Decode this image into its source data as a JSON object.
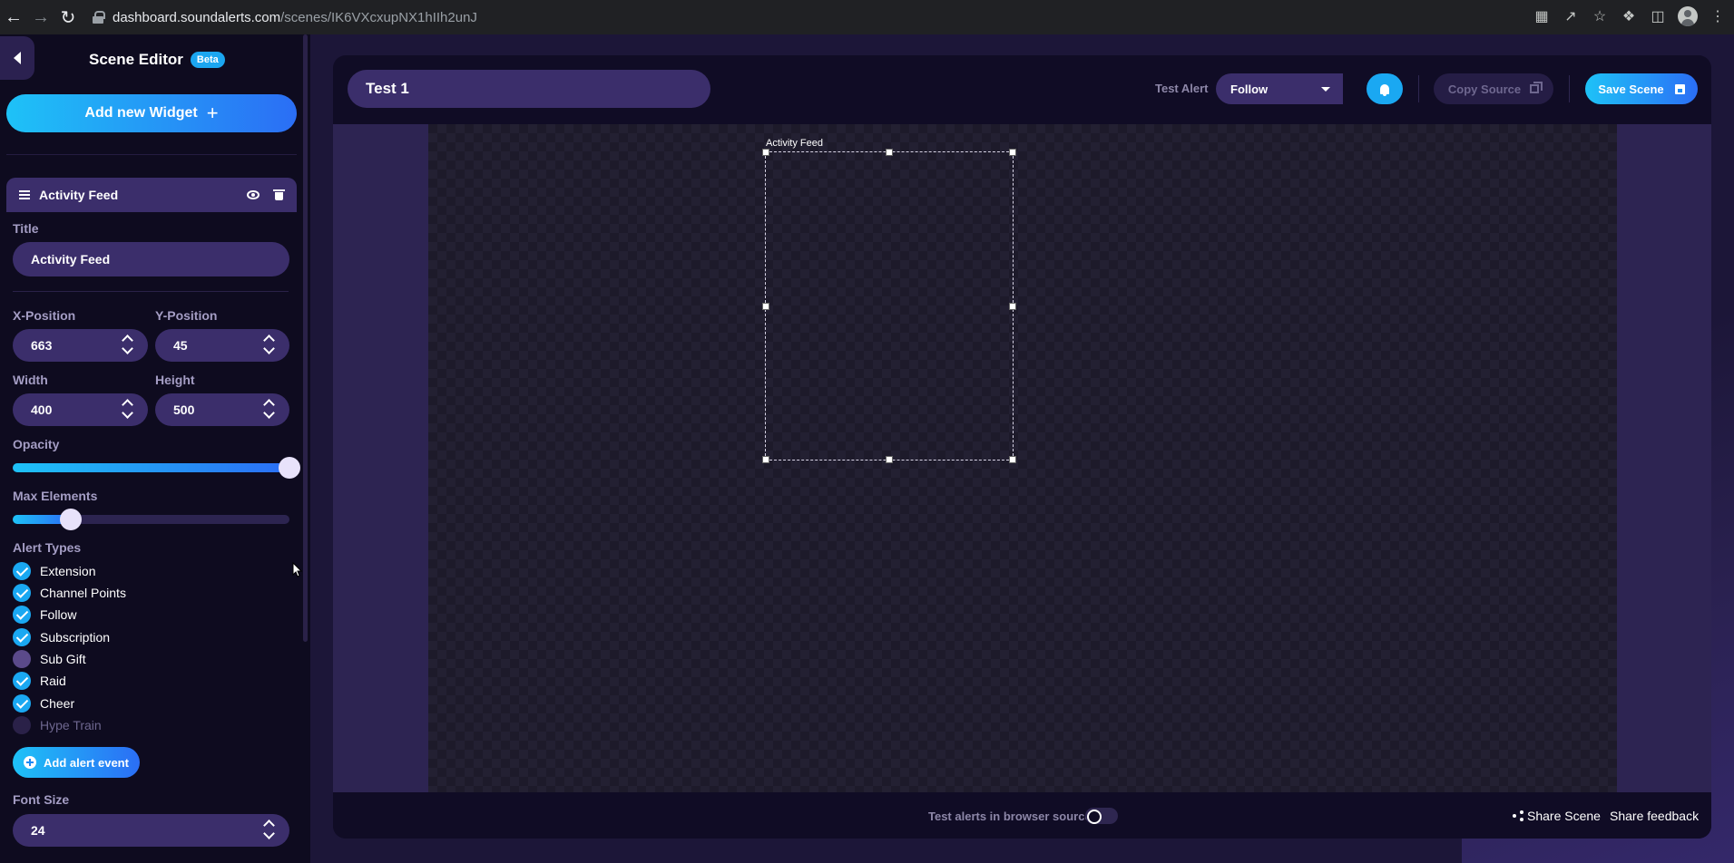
{
  "browser": {
    "url_host": "dashboard.soundalerts.com",
    "url_path": "/scenes/IK6VXcxupNX1hIIh2unJ"
  },
  "sidebar": {
    "title": "Scene Editor",
    "badge": "Beta",
    "add_widget_label": "Add new Widget",
    "widget": {
      "name": "Activity Feed",
      "title_label": "Title",
      "title_value": "Activity Feed",
      "x_label": "X-Position",
      "x_value": "663",
      "y_label": "Y-Position",
      "y_value": "45",
      "width_label": "Width",
      "width_value": "400",
      "height_label": "Height",
      "height_value": "500",
      "opacity_label": "Opacity",
      "opacity_level": 1.0,
      "max_elements_label": "Max Elements",
      "max_elements_level": 0.21,
      "alert_types_label": "Alert Types",
      "alert_types": [
        {
          "label": "Extension",
          "checked": true
        },
        {
          "label": "Channel Points",
          "checked": true
        },
        {
          "label": "Follow",
          "checked": true
        },
        {
          "label": "Subscription",
          "checked": true
        },
        {
          "label": "Sub Gift",
          "checked": false
        },
        {
          "label": "Raid",
          "checked": true
        },
        {
          "label": "Cheer",
          "checked": true
        },
        {
          "label": "Hype Train",
          "checked": false
        }
      ],
      "add_alert_label": "Add alert event",
      "font_size_label": "Font Size",
      "font_size_value": "24"
    }
  },
  "editor": {
    "scene_name": "Test 1",
    "test_alert_label": "Test Alert",
    "test_alert_selected": "Follow",
    "copy_source_label": "Copy Source",
    "save_scene_label": "Save Scene",
    "canvas_widget_caption": "Activity Feed",
    "toggle_label": "Test alerts in browser source",
    "share_scene_label": "Share Scene",
    "feedback_label": "Share feedback"
  },
  "colors": {
    "accent_start": "#1ec2f7",
    "accent_end": "#2b6ef5",
    "panel": "#3b2e6b",
    "background": "#100c25"
  }
}
